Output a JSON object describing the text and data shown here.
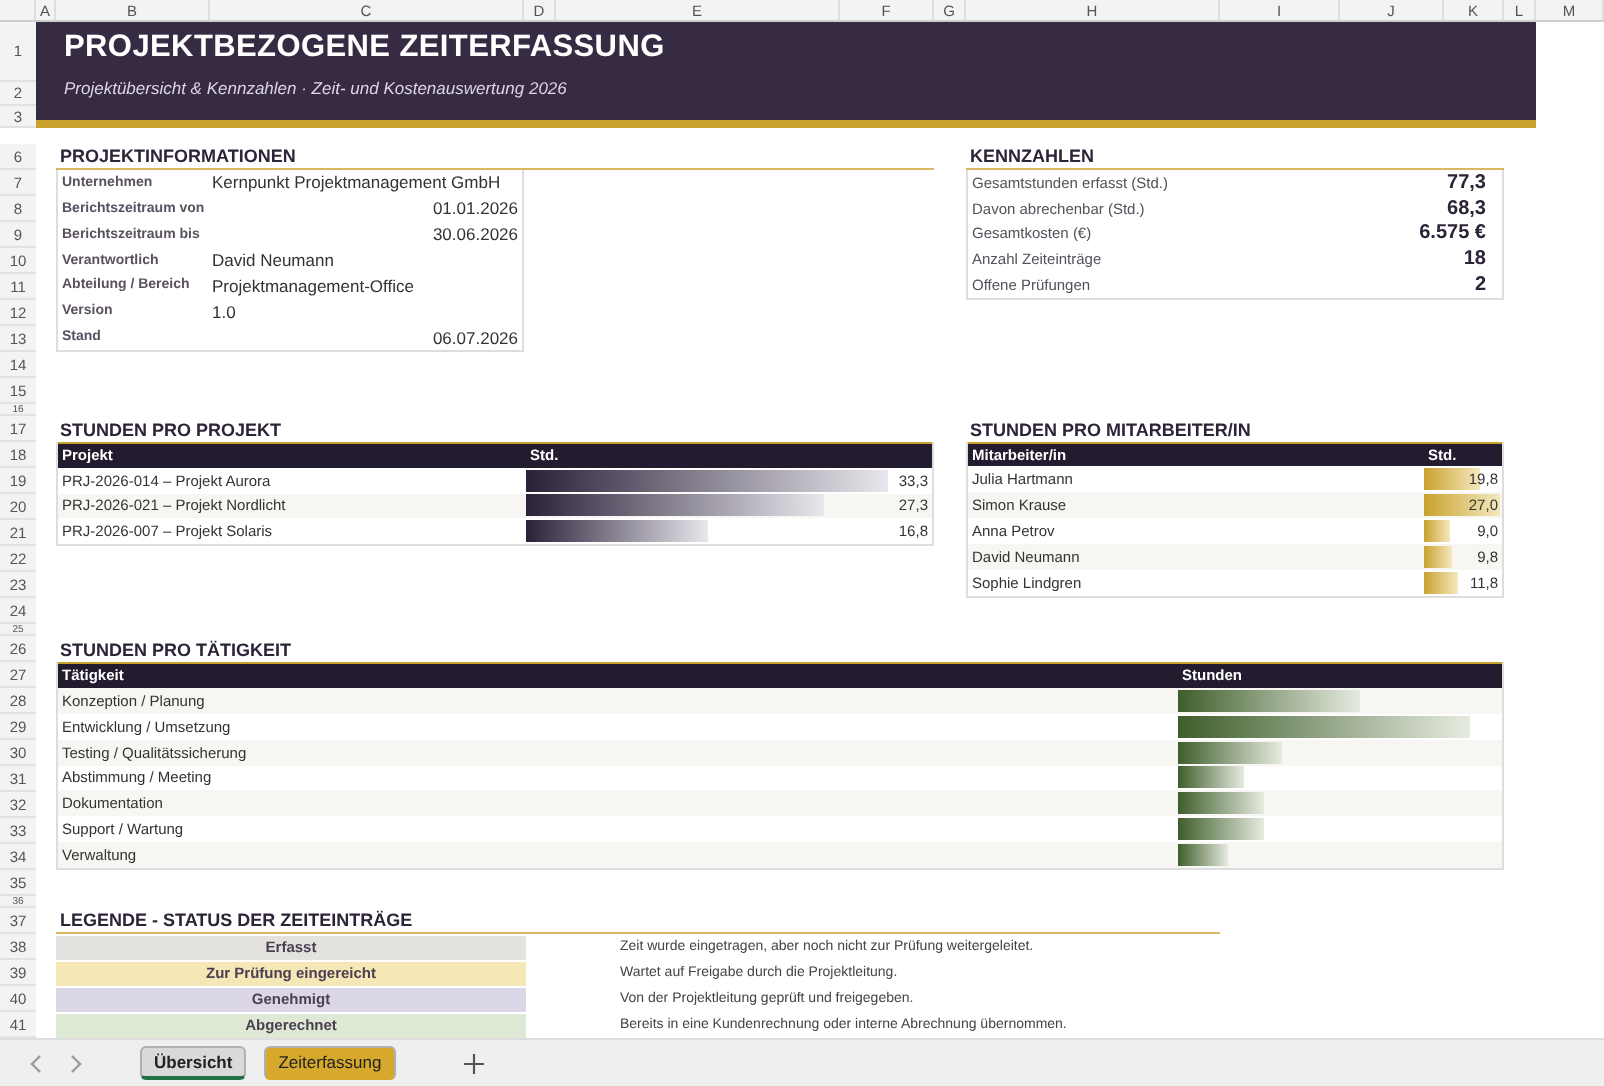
{
  "column_letters": [
    "A",
    "B",
    "C",
    "D",
    "E",
    "F",
    "G",
    "H",
    "I",
    "J",
    "K",
    "L",
    "M"
  ],
  "row_numbers": [
    "1",
    "2",
    "3",
    "6",
    "7",
    "8",
    "9",
    "10",
    "11",
    "12",
    "13",
    "14",
    "15",
    "16",
    "17",
    "18",
    "19",
    "20",
    "21",
    "22",
    "23",
    "24",
    "25",
    "26",
    "27",
    "28",
    "29",
    "30",
    "31",
    "32",
    "33",
    "34",
    "35",
    "36",
    "37",
    "38",
    "39",
    "40",
    "41"
  ],
  "header": {
    "title": "PROJEKTBEZOGENE ZEITERFASSUNG",
    "subtitle": "Projektübersicht & Kennzahlen · Zeit- und Kostenauswertung 2026"
  },
  "project_info": {
    "title": "PROJEKTINFORMATIONEN",
    "rows": [
      {
        "label": "Unternehmen",
        "value": "Kernpunkt Projektmanagement GmbH",
        "kind": "text"
      },
      {
        "label": "Berichtszeitraum von",
        "value": "01.01.2026",
        "kind": "date"
      },
      {
        "label": "Berichtszeitraum bis",
        "value": "30.06.2026",
        "kind": "date"
      },
      {
        "label": "Verantwortlich",
        "value": "David Neumann",
        "kind": "text"
      },
      {
        "label": "Abteilung / Bereich",
        "value": "Projektmanagement-Office",
        "kind": "text"
      },
      {
        "label": "Version",
        "value": "1.0",
        "kind": "text"
      },
      {
        "label": "Stand",
        "value": "06.07.2026",
        "kind": "date"
      }
    ]
  },
  "kpis": {
    "title": "KENNZAHLEN",
    "rows": [
      {
        "label": "Gesamtstunden erfasst (Std.)",
        "value": "77,3"
      },
      {
        "label": "Davon abrechenbar (Std.)",
        "value": "68,3"
      },
      {
        "label": "Gesamtkosten (€)",
        "value": "6.575 €"
      },
      {
        "label": "Anzahl Zeiteinträge",
        "value": "18"
      },
      {
        "label": "Offene Prüfungen",
        "value": "2"
      }
    ]
  },
  "hours_by_project": {
    "title": "STUNDEN PRO PROJEKT",
    "columns": [
      "Projekt",
      "Std."
    ],
    "rows": [
      {
        "name": "PRJ-2026-014 – Projekt Aurora",
        "value": "33,3"
      },
      {
        "name": "PRJ-2026-021 – Projekt Nordlicht",
        "value": "27,3"
      },
      {
        "name": "PRJ-2026-007 – Projekt Solaris",
        "value": "16,8"
      }
    ]
  },
  "hours_by_employee": {
    "title": "STUNDEN PRO MITARBEITER/IN",
    "columns": [
      "Mitarbeiter/in",
      "Std."
    ],
    "rows": [
      {
        "name": "Julia Hartmann",
        "value": "19,8"
      },
      {
        "name": "Simon Krause",
        "value": "27,0"
      },
      {
        "name": "Anna Petrov",
        "value": "9,0"
      },
      {
        "name": "David Neumann",
        "value": "9,8"
      },
      {
        "name": "Sophie Lindgren",
        "value": "11,8"
      }
    ]
  },
  "hours_by_activity": {
    "title": "STUNDEN PRO TÄTIGKEIT",
    "columns": [
      "Tätigkeit",
      "Stunden"
    ],
    "rows": [
      {
        "name": "Konzeption / Planung"
      },
      {
        "name": "Entwicklung / Umsetzung"
      },
      {
        "name": "Testing / Qualitätssicherung"
      },
      {
        "name": "Abstimmung / Meeting"
      },
      {
        "name": "Dokumentation"
      },
      {
        "name": "Support / Wartung"
      },
      {
        "name": "Verwaltung"
      }
    ]
  },
  "legend": {
    "title": "LEGENDE - STATUS DER ZEITEINTRÄGE",
    "items": [
      {
        "status": "Erfasst",
        "color": "#e4e2de",
        "description": "Zeit wurde eingetragen, aber noch nicht zur Prüfung weitergeleitet."
      },
      {
        "status": "Zur Prüfung eingereicht",
        "color": "#f6e7b6",
        "description": "Wartet auf Freigabe durch die Projektleitung."
      },
      {
        "status": "Genehmigt",
        "color": "#dcd7e6",
        "description": "Von der Projektleitung geprüft und freigegeben."
      },
      {
        "status": "Abgerechnet",
        "color": "#dde9d4",
        "description": "Bereits in eine Kundenrechnung oder interne Abrechnung übernommen."
      }
    ]
  },
  "sheet_tabs": [
    {
      "label": "Übersicht",
      "selected": true,
      "color": "#d9d9d9"
    },
    {
      "label": "Zeiterfassung",
      "selected": false,
      "color": "#d6a92c"
    }
  ]
}
